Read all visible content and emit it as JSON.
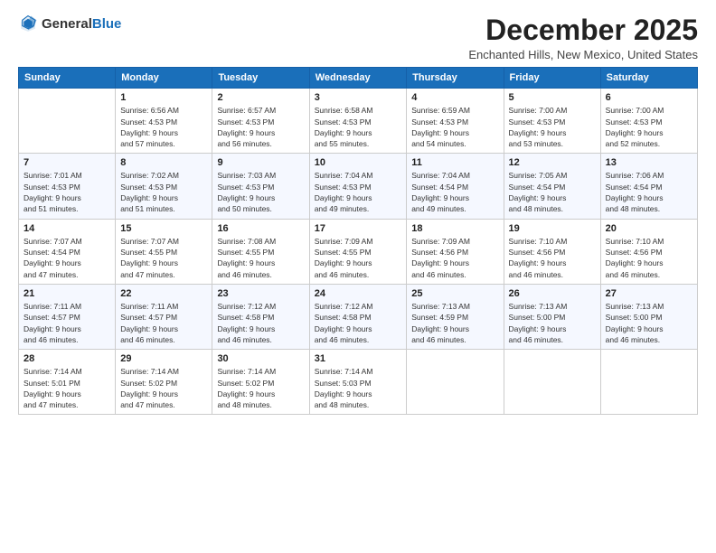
{
  "header": {
    "logo_general": "General",
    "logo_blue": "Blue",
    "month_title": "December 2025",
    "subtitle": "Enchanted Hills, New Mexico, United States"
  },
  "weekdays": [
    "Sunday",
    "Monday",
    "Tuesday",
    "Wednesday",
    "Thursday",
    "Friday",
    "Saturday"
  ],
  "weeks": [
    [
      {
        "day": "",
        "info": ""
      },
      {
        "day": "1",
        "info": "Sunrise: 6:56 AM\nSunset: 4:53 PM\nDaylight: 9 hours\nand 57 minutes."
      },
      {
        "day": "2",
        "info": "Sunrise: 6:57 AM\nSunset: 4:53 PM\nDaylight: 9 hours\nand 56 minutes."
      },
      {
        "day": "3",
        "info": "Sunrise: 6:58 AM\nSunset: 4:53 PM\nDaylight: 9 hours\nand 55 minutes."
      },
      {
        "day": "4",
        "info": "Sunrise: 6:59 AM\nSunset: 4:53 PM\nDaylight: 9 hours\nand 54 minutes."
      },
      {
        "day": "5",
        "info": "Sunrise: 7:00 AM\nSunset: 4:53 PM\nDaylight: 9 hours\nand 53 minutes."
      },
      {
        "day": "6",
        "info": "Sunrise: 7:00 AM\nSunset: 4:53 PM\nDaylight: 9 hours\nand 52 minutes."
      }
    ],
    [
      {
        "day": "7",
        "info": "Sunrise: 7:01 AM\nSunset: 4:53 PM\nDaylight: 9 hours\nand 51 minutes."
      },
      {
        "day": "8",
        "info": "Sunrise: 7:02 AM\nSunset: 4:53 PM\nDaylight: 9 hours\nand 51 minutes."
      },
      {
        "day": "9",
        "info": "Sunrise: 7:03 AM\nSunset: 4:53 PM\nDaylight: 9 hours\nand 50 minutes."
      },
      {
        "day": "10",
        "info": "Sunrise: 7:04 AM\nSunset: 4:53 PM\nDaylight: 9 hours\nand 49 minutes."
      },
      {
        "day": "11",
        "info": "Sunrise: 7:04 AM\nSunset: 4:54 PM\nDaylight: 9 hours\nand 49 minutes."
      },
      {
        "day": "12",
        "info": "Sunrise: 7:05 AM\nSunset: 4:54 PM\nDaylight: 9 hours\nand 48 minutes."
      },
      {
        "day": "13",
        "info": "Sunrise: 7:06 AM\nSunset: 4:54 PM\nDaylight: 9 hours\nand 48 minutes."
      }
    ],
    [
      {
        "day": "14",
        "info": "Sunrise: 7:07 AM\nSunset: 4:54 PM\nDaylight: 9 hours\nand 47 minutes."
      },
      {
        "day": "15",
        "info": "Sunrise: 7:07 AM\nSunset: 4:55 PM\nDaylight: 9 hours\nand 47 minutes."
      },
      {
        "day": "16",
        "info": "Sunrise: 7:08 AM\nSunset: 4:55 PM\nDaylight: 9 hours\nand 46 minutes."
      },
      {
        "day": "17",
        "info": "Sunrise: 7:09 AM\nSunset: 4:55 PM\nDaylight: 9 hours\nand 46 minutes."
      },
      {
        "day": "18",
        "info": "Sunrise: 7:09 AM\nSunset: 4:56 PM\nDaylight: 9 hours\nand 46 minutes."
      },
      {
        "day": "19",
        "info": "Sunrise: 7:10 AM\nSunset: 4:56 PM\nDaylight: 9 hours\nand 46 minutes."
      },
      {
        "day": "20",
        "info": "Sunrise: 7:10 AM\nSunset: 4:56 PM\nDaylight: 9 hours\nand 46 minutes."
      }
    ],
    [
      {
        "day": "21",
        "info": "Sunrise: 7:11 AM\nSunset: 4:57 PM\nDaylight: 9 hours\nand 46 minutes."
      },
      {
        "day": "22",
        "info": "Sunrise: 7:11 AM\nSunset: 4:57 PM\nDaylight: 9 hours\nand 46 minutes."
      },
      {
        "day": "23",
        "info": "Sunrise: 7:12 AM\nSunset: 4:58 PM\nDaylight: 9 hours\nand 46 minutes."
      },
      {
        "day": "24",
        "info": "Sunrise: 7:12 AM\nSunset: 4:58 PM\nDaylight: 9 hours\nand 46 minutes."
      },
      {
        "day": "25",
        "info": "Sunrise: 7:13 AM\nSunset: 4:59 PM\nDaylight: 9 hours\nand 46 minutes."
      },
      {
        "day": "26",
        "info": "Sunrise: 7:13 AM\nSunset: 5:00 PM\nDaylight: 9 hours\nand 46 minutes."
      },
      {
        "day": "27",
        "info": "Sunrise: 7:13 AM\nSunset: 5:00 PM\nDaylight: 9 hours\nand 46 minutes."
      }
    ],
    [
      {
        "day": "28",
        "info": "Sunrise: 7:14 AM\nSunset: 5:01 PM\nDaylight: 9 hours\nand 47 minutes."
      },
      {
        "day": "29",
        "info": "Sunrise: 7:14 AM\nSunset: 5:02 PM\nDaylight: 9 hours\nand 47 minutes."
      },
      {
        "day": "30",
        "info": "Sunrise: 7:14 AM\nSunset: 5:02 PM\nDaylight: 9 hours\nand 48 minutes."
      },
      {
        "day": "31",
        "info": "Sunrise: 7:14 AM\nSunset: 5:03 PM\nDaylight: 9 hours\nand 48 minutes."
      },
      {
        "day": "",
        "info": ""
      },
      {
        "day": "",
        "info": ""
      },
      {
        "day": "",
        "info": ""
      }
    ]
  ]
}
